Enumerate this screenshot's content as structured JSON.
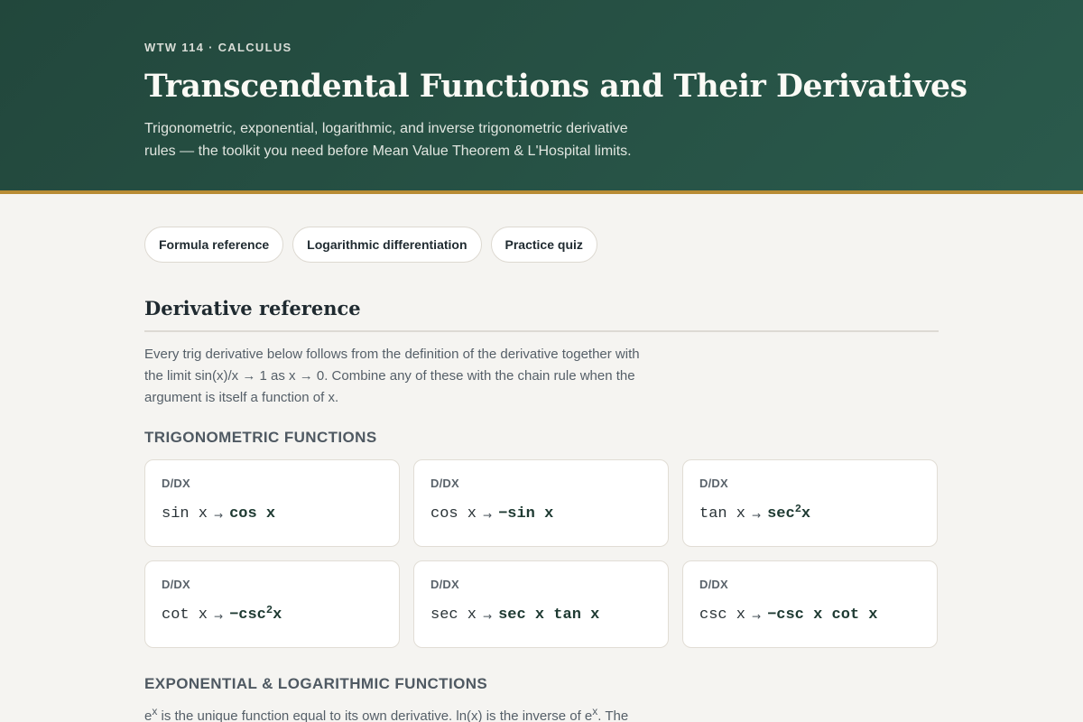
{
  "hero": {
    "eyebrow": "WTW 114 · CALCULUS",
    "title": "Transcendental Functions and Their Derivatives",
    "subtitle": "Trigonometric, exponential, logarithmic, and inverse trigonometric derivative rules — the toolkit you need before Mean Value Theorem & L'Hospital limits."
  },
  "tabs": [
    "Formula reference",
    "Logarithmic differentiation",
    "Practice quiz"
  ],
  "section": {
    "title": "Derivative reference",
    "description": "Every trig derivative below follows from the definition of the derivative together with the limit sin(x)/x → 1 as x → 0. Combine any of these with the chain rule when the argument is itself a function of x."
  },
  "trig": {
    "label": "TRIGONOMETRIC FUNCTIONS",
    "cards": [
      {
        "op": "D/DX",
        "fn": "sin x",
        "arrow": "→",
        "result": "cos x",
        "sup": "",
        "tail": ""
      },
      {
        "op": "D/DX",
        "fn": "cos x",
        "arrow": "→",
        "result": "−sin x",
        "sup": "",
        "tail": ""
      },
      {
        "op": "D/DX",
        "fn": "tan x",
        "arrow": "→",
        "result": "sec",
        "sup": "2",
        "tail": "x"
      },
      {
        "op": "D/DX",
        "fn": "cot x",
        "arrow": "→",
        "result": "−csc",
        "sup": "2",
        "tail": "x"
      },
      {
        "op": "D/DX",
        "fn": "sec x",
        "arrow": "→",
        "result": "sec x tan x",
        "sup": "",
        "tail": ""
      },
      {
        "op": "D/DX",
        "fn": "csc x",
        "arrow": "→",
        "result": "−csc x cot x",
        "sup": "",
        "tail": ""
      }
    ]
  },
  "explog": {
    "label": "EXPONENTIAL & LOGARITHMIC FUNCTIONS",
    "text_a": "e",
    "sup_a": "x",
    "text_b": " is the unique function equal to its own derivative. ln(x) is the inverse of e",
    "sup_b": "x",
    "text_c": ". The"
  },
  "colors": {
    "hero_bg": "#22473c",
    "accent_border": "#b88c35",
    "page_bg": "#f5f4f1"
  }
}
